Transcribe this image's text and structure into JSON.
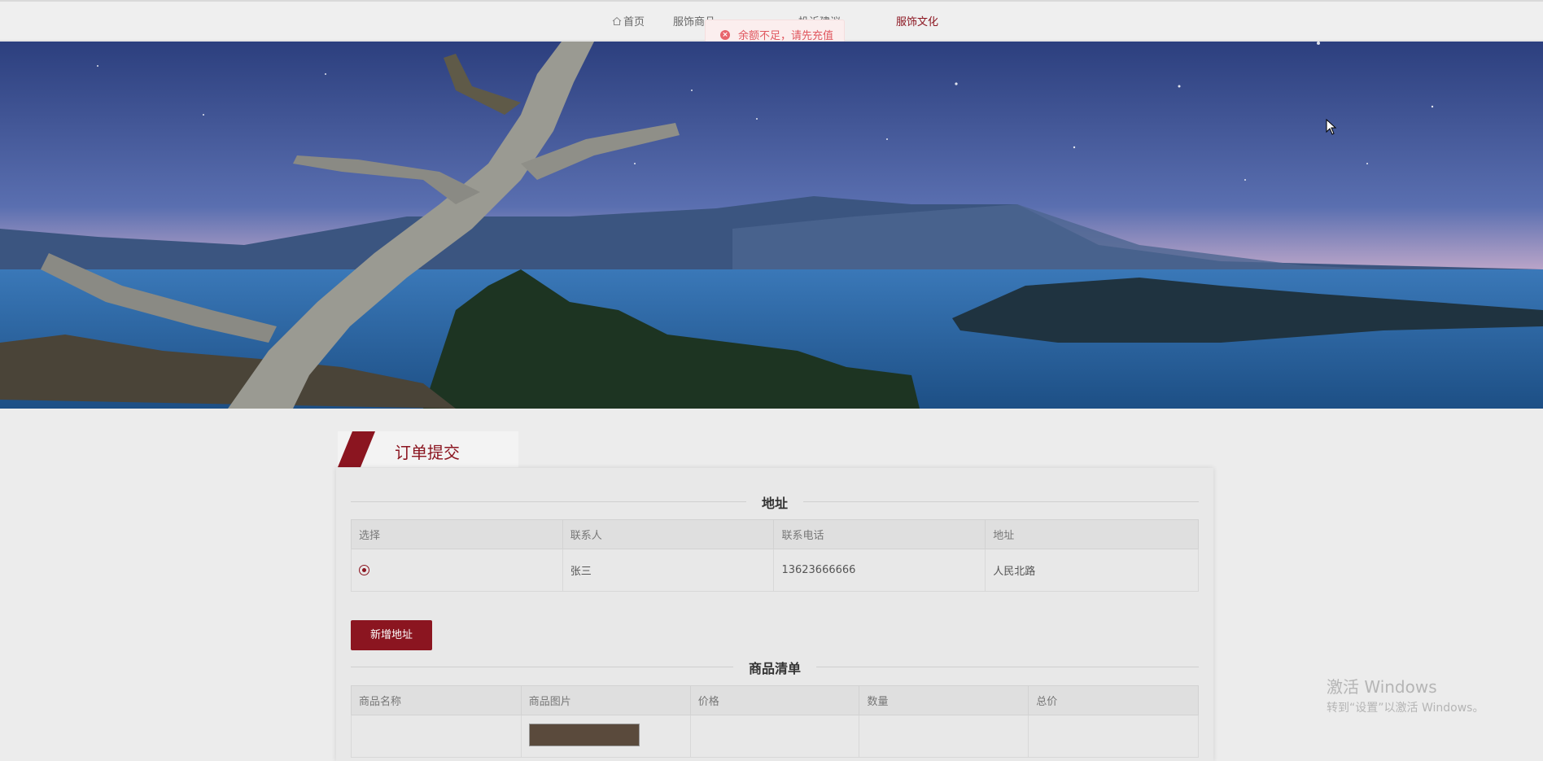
{
  "nav": {
    "items": [
      {
        "label": "首页"
      },
      {
        "label": "服饰商品"
      },
      {
        "label": "投诉建议"
      },
      {
        "label": "服饰文化"
      }
    ]
  },
  "toast": {
    "message": "余额不足，请先充值",
    "icon": "error-circle-icon",
    "color": "#e0575f"
  },
  "banner": {
    "icon": "landscape-image"
  },
  "page": {
    "title": "订单提交",
    "accent": "#8b1520"
  },
  "address_section": {
    "title": "地址",
    "columns": [
      "选择",
      "联系人",
      "联系电话",
      "地址"
    ],
    "rows": [
      {
        "selected": true,
        "contact": "张三",
        "phone": "13623666666",
        "address": "人民北路"
      }
    ],
    "add_button": "新增地址"
  },
  "product_section": {
    "title": "商品清单",
    "columns": [
      "商品名称",
      "商品图片",
      "价格",
      "数量",
      "总价"
    ]
  },
  "watermark": {
    "line1": "激活 Windows",
    "line2": "转到“设置”以激活 Windows。"
  }
}
